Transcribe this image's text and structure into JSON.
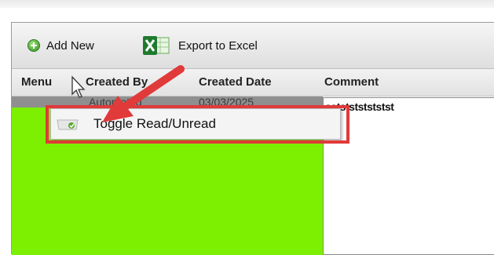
{
  "toolbar": {
    "add_new_label": "Add New",
    "export_label": "Export to Excel",
    "add_icon": "add-circle-icon",
    "export_icon": "excel-icon"
  },
  "grid": {
    "columns": [
      "Menu",
      "Created By",
      "Created Date",
      "Comment"
    ],
    "row": {
      "created_by": "Automated",
      "created_date": "03/03/2025",
      "comment": "sststststststst"
    }
  },
  "context_menu": {
    "items": [
      {
        "label": "Toggle Read/Unread",
        "icon": "toggle-read-icon"
      }
    ]
  },
  "colors": {
    "row_highlight": "#7cf000",
    "annotation": "#e03a3a"
  }
}
